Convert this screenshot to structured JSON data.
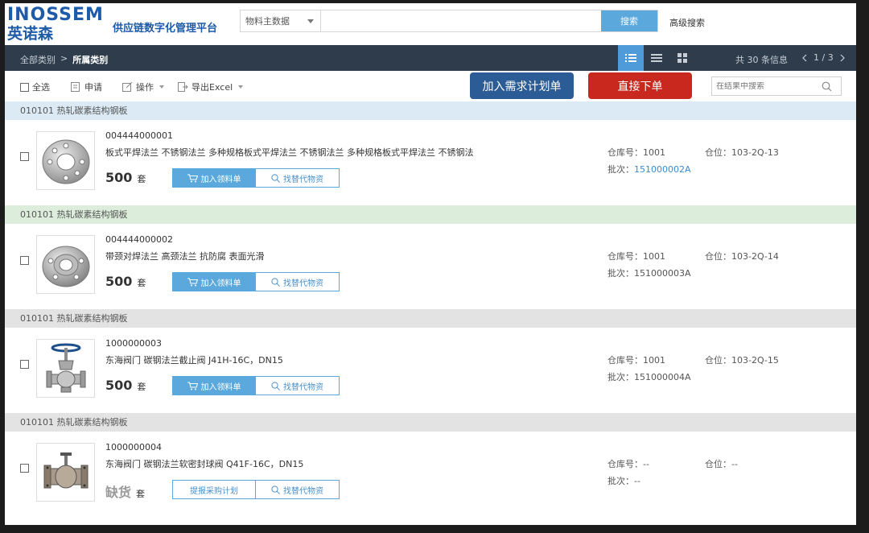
{
  "brand": {
    "logo_en": "INOSSEM",
    "logo_cn": "英诺森",
    "tagline": "供应链数字化管理平台"
  },
  "search": {
    "category": "物料主数据",
    "placeholder": "",
    "button": "搜索",
    "advanced": "高级搜索"
  },
  "nav": {
    "breadcrumb_root": "全部类别",
    "breadcrumb_sep": ">",
    "breadcrumb_current": "所属类别",
    "total_text": "共 30 条信息",
    "page_text": "1 / 3",
    "views": [
      "list-view-icon",
      "detail-list-icon",
      "grid-view-icon"
    ]
  },
  "toolbar": {
    "select_all": "全选",
    "apply": "申请",
    "operate": "操作",
    "export": "导出Excel",
    "add_plan": "加入需求计划单",
    "direct_order": "直接下单",
    "filter_placeholder": "在结果中搜索"
  },
  "labels": {
    "warehouse": "仓库号：",
    "location": "仓位：",
    "batch": "批次："
  },
  "groups": [
    {
      "category": "010101 热轧碳素结构钢板",
      "code": "004444000001",
      "desc": "板式平焊法兰 不锈钢法兰 多种规格板式平焊法兰 不锈钢法兰 多种规格板式平焊法兰 不锈钢法",
      "qty": "500",
      "unit": "套",
      "action1": "加入领料单",
      "action2": "找替代物资",
      "warehouse": "1001",
      "location": "103-2Q-13",
      "batch": "151000002A",
      "icon": "flange-plate-icon"
    },
    {
      "category": "010101 热轧碳素结构钢板",
      "code": "004444000002",
      "desc": "带颈对焊法兰 高颈法兰 抗防腐 表面光滑",
      "qty": "500",
      "unit": "套",
      "action1": "加入领料单",
      "action2": "找替代物资",
      "warehouse": "1001",
      "location": "103-2Q-14",
      "batch": "151000003A",
      "icon": "flange-neck-icon"
    },
    {
      "category": "010101 热轧碳素结构钢板",
      "code": "1000000003",
      "desc": "东海阀门 碳钢法兰截止阀 J41H-16C，DN15",
      "qty": "500",
      "unit": "套",
      "action1": "加入领料单",
      "action2": "找替代物资",
      "warehouse": "1001",
      "location": "103-2Q-15",
      "batch": "151000004A",
      "icon": "globe-valve-icon"
    },
    {
      "category": "010101 热轧碳素结构钢板",
      "code": "1000000004",
      "desc": "东海阀门 碳钢法兰软密封球阀 Q41F-16C，DN15",
      "qty": "缺货",
      "unit": "套",
      "action1": "提报采购计划",
      "action2": "找替代物资",
      "warehouse": "--",
      "location": "--",
      "batch": "--",
      "icon": "ball-valve-icon"
    }
  ],
  "colors": {
    "brand": "#1e5ba8",
    "nav_bg": "#2e3c4b",
    "accent": "#5aa8dc",
    "plan_btn": "#2c5c95",
    "order_btn": "#c8281e"
  }
}
